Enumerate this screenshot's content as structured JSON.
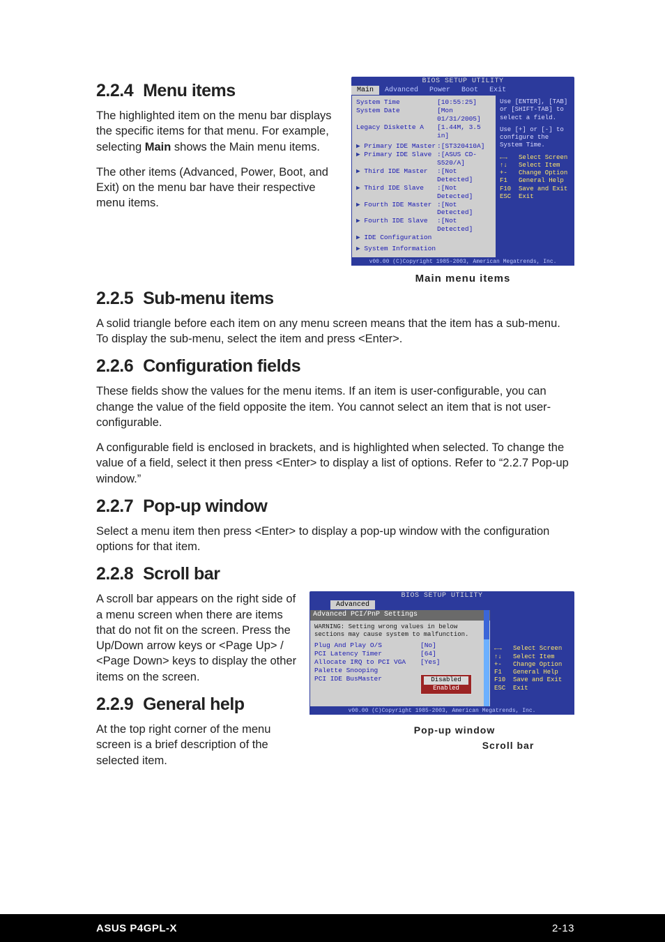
{
  "footer": {
    "left": "ASUS P4GPL-X",
    "right": "2-13"
  },
  "s224": {
    "num": "2.2.4",
    "title": "Menu items",
    "p1": "The highlighted item on the menu bar  displays the specific items for that menu. For example, selecting",
    "p1b": "Main",
    "p1c": " shows the Main menu items.",
    "p2": "The other items (Advanced, Power, Boot, and Exit) on the menu bar have their respective menu items."
  },
  "bios1": {
    "bar": "BIOS SETUP UTILITY",
    "menu": {
      "main": "Main",
      "advanced": "Advanced",
      "power": "Power",
      "boot": "Boot",
      "exit": "Exit"
    },
    "rows": [
      {
        "k": "System Time",
        "v": "[10:55:25]"
      },
      {
        "k": "System Date",
        "v": "[Mon 01/31/2005]"
      },
      {
        "k": "Legacy Diskette A",
        "v": "[1.44M, 3.5 in]"
      }
    ],
    "sub": [
      {
        "k": "Primary IDE Master",
        "v": ":[ST320410A]"
      },
      {
        "k": "Primary IDE Slave",
        "v": ":[ASUS CD-S520/A]"
      },
      {
        "k": "Third IDE Master",
        "v": ":[Not Detected]"
      },
      {
        "k": "Third IDE Slave",
        "v": ":[Not Detected]"
      },
      {
        "k": "Fourth IDE Master",
        "v": ":[Not Detected]"
      },
      {
        "k": "Fourth IDE Slave",
        "v": ":[Not Detected]"
      },
      {
        "k": "IDE Configuration",
        "v": ""
      }
    ],
    "sysinfo": "System Information",
    "help1": "Use [ENTER], [TAB] or [SHIFT-TAB] to select a field.",
    "help2": "Use [+] or [-] to configure the System Time.",
    "keys": "←→   Select Screen\n↑↓   Select Item\n+-   Change Option\nF1   General Help\nF10  Save and Exit\nESC  Exit",
    "footer": "v00.00 (C)Copyright 1985-2003, American Megatrends, Inc.",
    "caption": "Main menu items"
  },
  "s225": {
    "num": "2.2.5",
    "title": "Sub-menu items",
    "p": "A solid triangle before each item on any menu screen means that the item has a sub-menu. To display the sub-menu, select the item and press <Enter>."
  },
  "s226": {
    "num": "2.2.6",
    "title": "Configuration fields",
    "p1": "These fields show the values for the menu items. If an item is user-configurable, you can change the value of the field opposite the item. You cannot select an item that is not user-configurable.",
    "p2": "A configurable field is enclosed in brackets, and is highlighted when selected. To change the value of a field, select it then press <Enter> to display a list of options. Refer to “2.2.7 Pop-up window.”"
  },
  "s227": {
    "num": "2.2.7",
    "title": "Pop-up window",
    "p": "Select a menu item then press <Enter> to display a pop-up window with the configuration options for that item."
  },
  "s228": {
    "num": "2.2.8",
    "title": "Scroll bar",
    "p": "A scroll bar appears on the right side of a menu screen when there are items that do not fit on the screen. Press the\nUp/Down arrow keys or <Page Up> / <Page Down> keys to display the other items on the screen."
  },
  "bios2": {
    "bar": "BIOS SETUP UTILITY",
    "menu_active": "Advanced",
    "panel_title": "Advanced PCI/PnP Settings",
    "warn": "WARNING: Setting wrong values in below sections may cause system to malfunction.",
    "rows": [
      {
        "k": "Plug And Play O/S",
        "v": "[No]"
      },
      {
        "k": "PCI Latency Timer",
        "v": "[64]"
      },
      {
        "k": "Allocate IRQ to PCI VGA",
        "v": "[Yes]"
      },
      {
        "k": "Palette Snooping",
        "v": ""
      },
      {
        "k": "PCI IDE BusMaster",
        "v": ""
      }
    ],
    "popup": {
      "opt1": "Disabled",
      "opt2": "Enabled"
    },
    "keys": "←→   Select Screen\n↑↓   Select Item\n+-   Change Option\nF1   General Help\nF10  Save and Exit\nESC  Exit",
    "footer": "v00.00 (C)Copyright 1985-2003, American Megatrends, Inc.",
    "callout1": "Pop-up window",
    "callout2": "Scroll bar"
  },
  "s229": {
    "num": "2.2.9",
    "title": "General help",
    "p": "At the top right corner of the menu screen is a brief description of the selected item."
  }
}
